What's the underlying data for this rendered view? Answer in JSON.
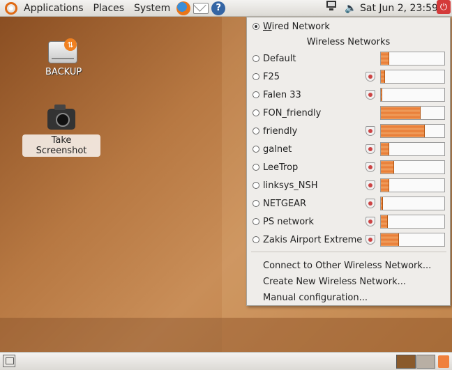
{
  "top_panel": {
    "menus": [
      "Applications",
      "Places",
      "System"
    ],
    "clock": "Sat Jun  2, 23:59"
  },
  "desktop": {
    "icons": [
      {
        "label": "BACKUP",
        "icon": "usb-drive-icon"
      },
      {
        "label": "Take Screenshot",
        "icon": "camera-icon"
      }
    ]
  },
  "network_menu": {
    "wired": {
      "label": "Wired Network",
      "selected": true
    },
    "wireless_header": "Wireless Networks",
    "networks": [
      {
        "name": "Default",
        "secured": false,
        "signal": 0.12
      },
      {
        "name": "F25",
        "secured": true,
        "signal": 0.06
      },
      {
        "name": "Falen 33",
        "secured": true,
        "signal": 0.0
      },
      {
        "name": "FON_friendly",
        "secured": false,
        "signal": 0.62
      },
      {
        "name": "friendly",
        "secured": true,
        "signal": 0.68
      },
      {
        "name": "galnet",
        "secured": true,
        "signal": 0.12
      },
      {
        "name": "LeeTrop",
        "secured": true,
        "signal": 0.2
      },
      {
        "name": "linksys_NSH",
        "secured": true,
        "signal": 0.12
      },
      {
        "name": "NETGEAR",
        "secured": true,
        "signal": 0.02
      },
      {
        "name": "PS network",
        "secured": true,
        "signal": 0.1
      },
      {
        "name": "Zakis Airport Extreme",
        "secured": true,
        "signal": 0.28
      }
    ],
    "actions": [
      "Connect to Other Wireless Network...",
      "Create New Wireless Network...",
      "Manual configuration..."
    ]
  },
  "colors": {
    "accent": "#e87a33",
    "panel": "#e6e4df",
    "menu_bg": "#efedea"
  }
}
